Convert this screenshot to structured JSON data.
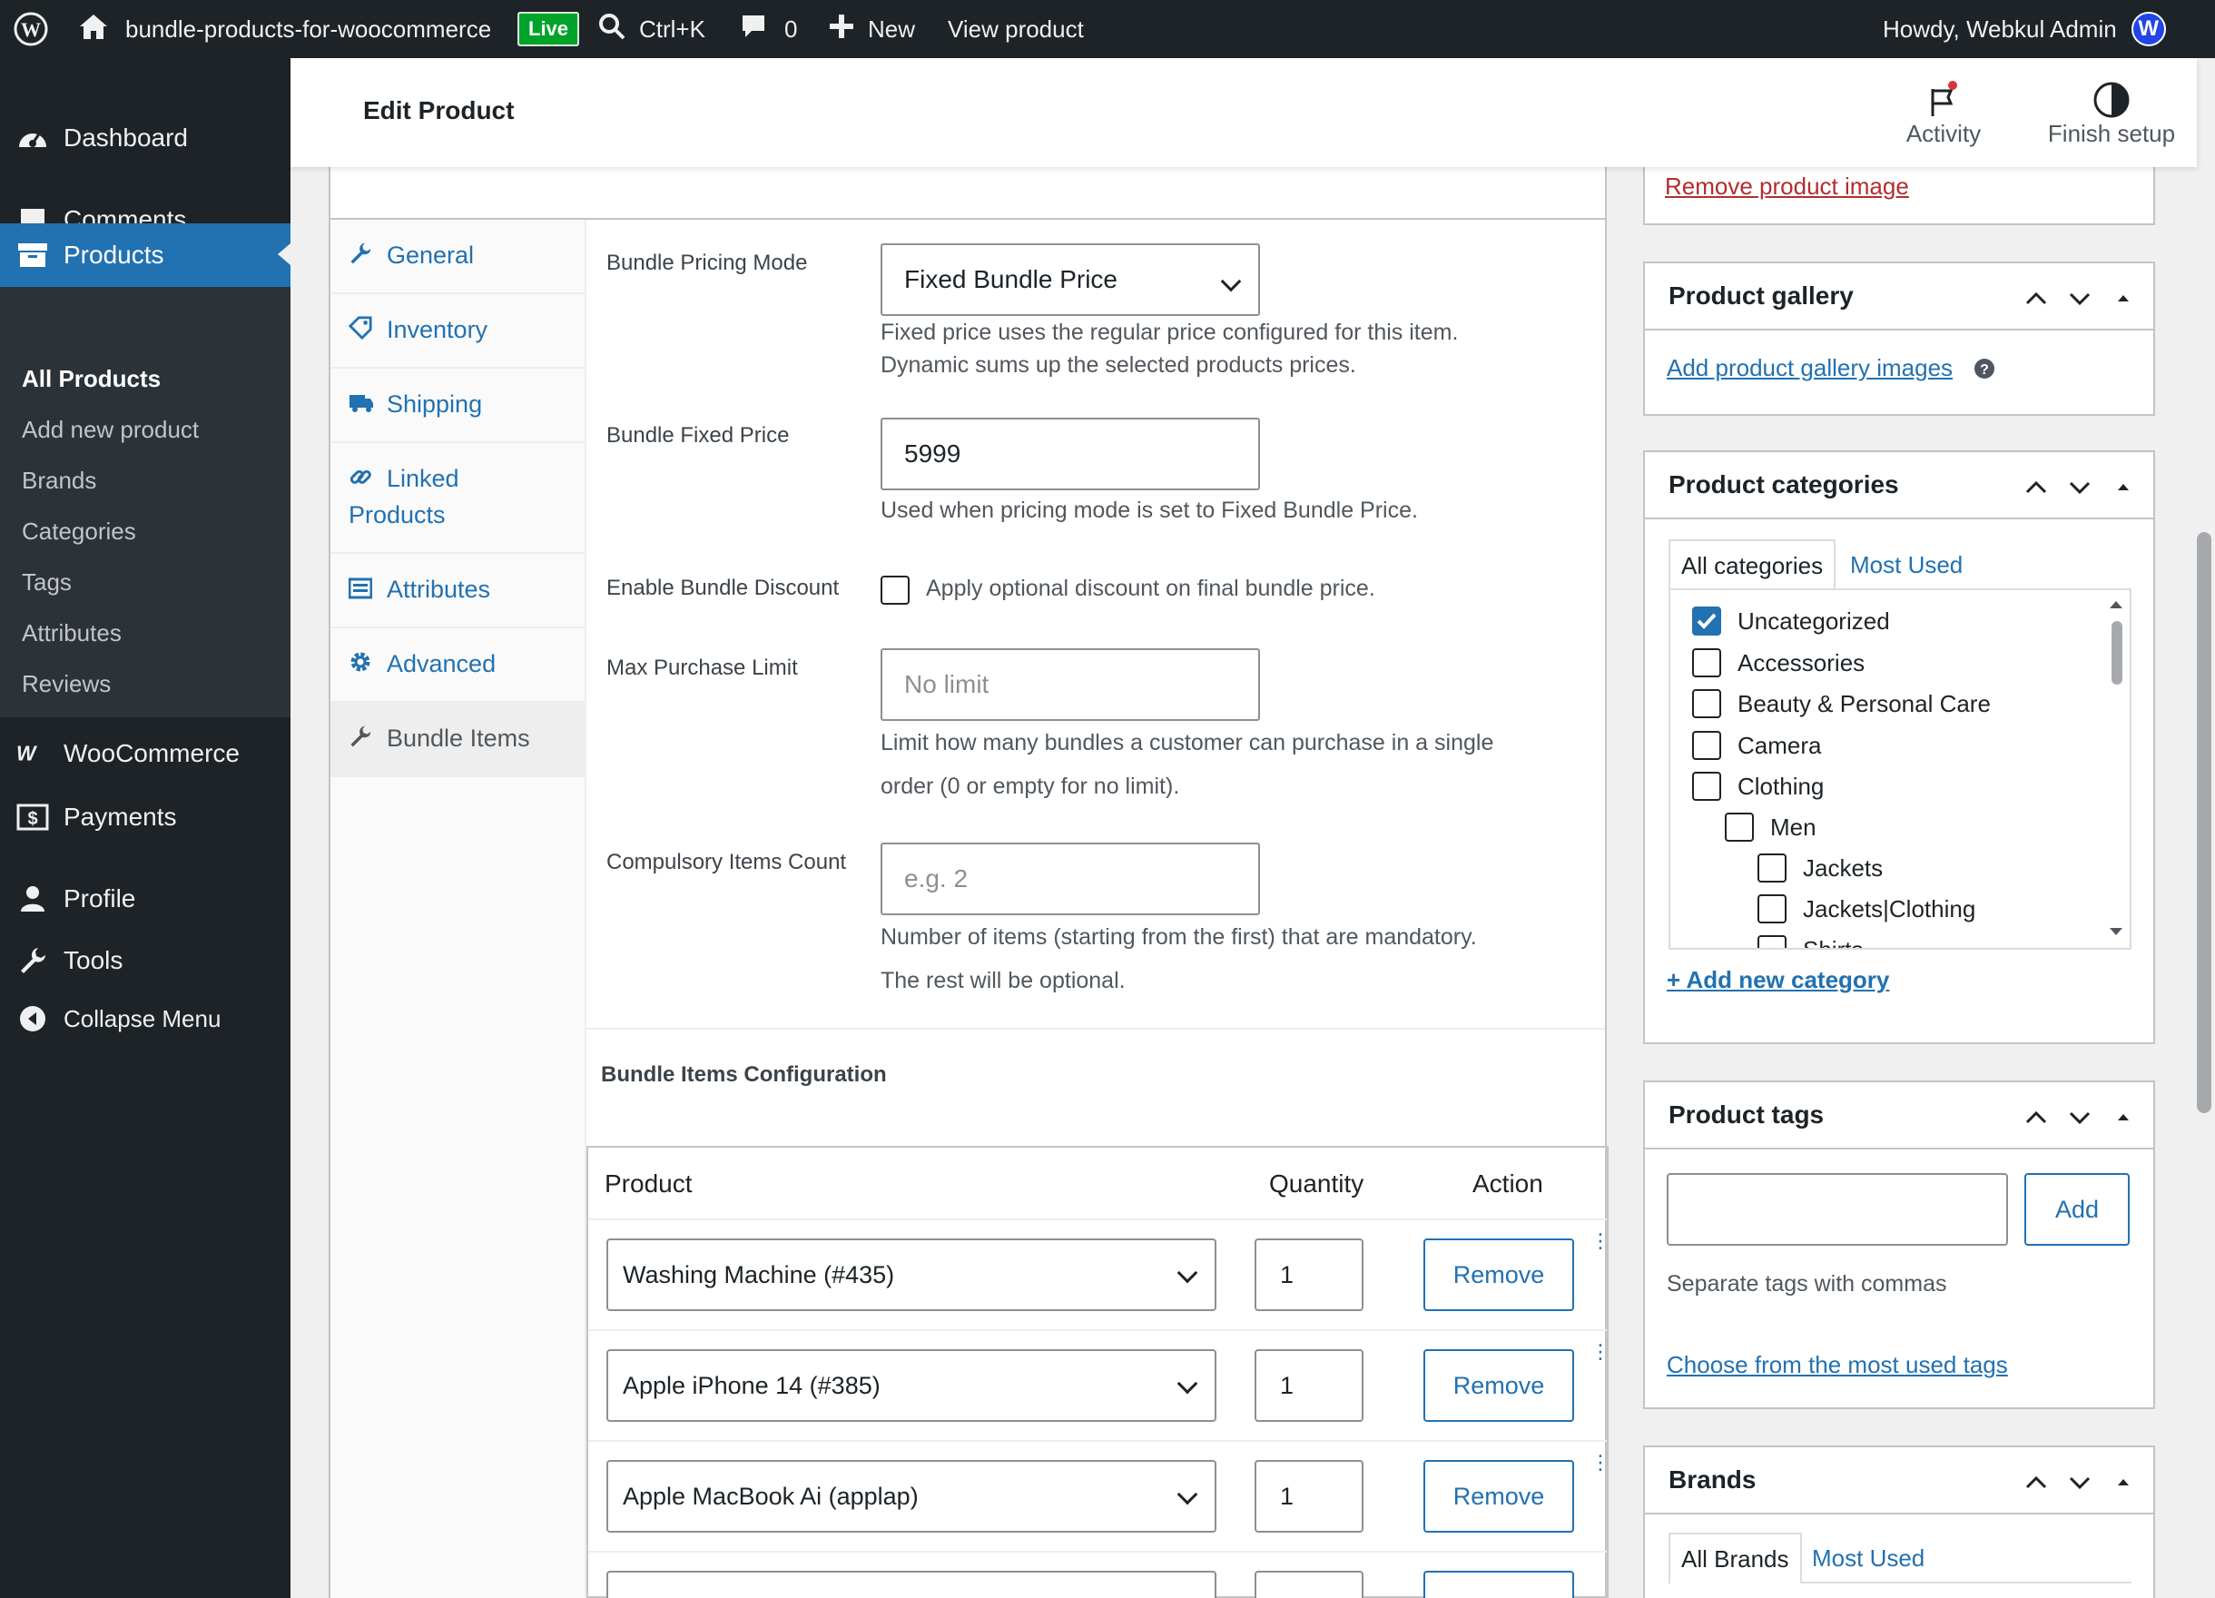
{
  "admin_bar": {
    "site_name": "bundle-products-for-woocommerce",
    "live_badge": "Live",
    "search_shortcut": "Ctrl+K",
    "comments_count": "0",
    "new_label": "New",
    "view_product": "View product",
    "howdy": "Howdy, Webkul Admin",
    "avatar_letter": "W"
  },
  "menu": {
    "dashboard": "Dashboard",
    "comments": "Comments",
    "products": "Products",
    "submenu": [
      "All Products",
      "Add new product",
      "Brands",
      "Categories",
      "Tags",
      "Attributes",
      "Reviews"
    ],
    "woocommerce": "WooCommerce",
    "payments": "Payments",
    "profile": "Profile",
    "tools": "Tools",
    "collapse": "Collapse Menu"
  },
  "header": {
    "title": "Edit Product",
    "activity": "Activity",
    "finish_setup": "Finish setup"
  },
  "product_data": {
    "tabs": [
      "General",
      "Inventory",
      "Shipping",
      "Linked Products",
      "Attributes",
      "Advanced",
      "Bundle Items"
    ],
    "tab_linked_line1": "Linked",
    "tab_linked_line2": "Products",
    "pricing_mode_label": "Bundle Pricing Mode",
    "pricing_mode_value": "Fixed Bundle Price",
    "pricing_mode_desc1": "Fixed price uses the regular price configured for this item.",
    "pricing_mode_desc2": "Dynamic sums up the selected products prices.",
    "fixed_price_label": "Bundle Fixed Price",
    "fixed_price_value": "5999",
    "fixed_price_desc": "Used when pricing mode is set to Fixed Bundle Price.",
    "discount_label": "Enable Bundle Discount",
    "discount_checkbox_label": "Apply optional discount on final bundle price.",
    "max_limit_label": "Max Purchase Limit",
    "max_limit_placeholder": "No limit",
    "max_limit_desc1": "Limit how many bundles a customer can purchase in a single",
    "max_limit_desc2": "order (0 or empty for no limit).",
    "compulsory_label": "Compulsory Items Count",
    "compulsory_placeholder": "e.g. 2",
    "compulsory_desc1": "Number of items (starting from the first) that are mandatory.",
    "compulsory_desc2": "The rest will be optional.",
    "config_heading": "Bundle Items Configuration",
    "table_headers": [
      "Product",
      "Quantity",
      "Action"
    ],
    "rows": [
      {
        "product": "Washing Machine (#435)",
        "qty": "1",
        "action": "Remove"
      },
      {
        "product": "Apple iPhone 14 (#385)",
        "qty": "1",
        "action": "Remove"
      },
      {
        "product": "Apple MacBook Ai (applap)",
        "qty": "1",
        "action": "Remove"
      }
    ]
  },
  "sidebar": {
    "remove_image": "Remove product image",
    "gallery_title": "Product gallery",
    "gallery_link": "Add product gallery images",
    "categories_title": "Product categories",
    "cat_tab_all": "All categories",
    "cat_tab_most": "Most Used",
    "categories": [
      {
        "name": "Uncategorized",
        "checked": true,
        "level": 0
      },
      {
        "name": "Accessories",
        "checked": false,
        "level": 0
      },
      {
        "name": "Beauty & Personal Care",
        "checked": false,
        "level": 0
      },
      {
        "name": "Camera",
        "checked": false,
        "level": 0
      },
      {
        "name": "Clothing",
        "checked": false,
        "level": 0
      },
      {
        "name": "Men",
        "checked": false,
        "level": 1
      },
      {
        "name": "Jackets",
        "checked": false,
        "level": 2
      },
      {
        "name": "Jackets|Clothing",
        "checked": false,
        "level": 2
      },
      {
        "name": "Shirts",
        "checked": false,
        "level": 2
      }
    ],
    "add_category": "+ Add new category",
    "tags_title": "Product tags",
    "tags_add": "Add",
    "tags_hint": "Separate tags with commas",
    "tags_choose": "Choose from the most used tags",
    "brands_title": "Brands",
    "brands_tab_all": "All Brands",
    "brands_tab_most": "Most Used"
  },
  "colors": {
    "admin_dark": "#1d2327",
    "accent": "#2271b1",
    "live": "#00a32a",
    "danger": "#b32d2e"
  }
}
